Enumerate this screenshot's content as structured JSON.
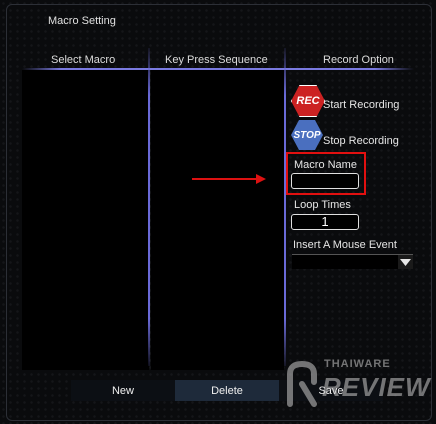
{
  "window": {
    "title": "Macro Setting"
  },
  "columns": {
    "select_macro": "Select Macro",
    "key_press_sequence": "Key Press Sequence",
    "record_option": "Record Option"
  },
  "record": {
    "rec_icon_text": "REC",
    "start_label": "Start Recording",
    "stop_icon_text": "STOP",
    "stop_label": "Stop Recording"
  },
  "macro_name": {
    "label": "Macro Name",
    "value": ""
  },
  "loop_times": {
    "label": "Loop Times",
    "value": "1"
  },
  "mouse_event": {
    "label": "Insert A Mouse Event",
    "selected": ""
  },
  "buttons": {
    "new": "New",
    "delete": "Delete",
    "save": "Save"
  },
  "watermark": {
    "line1": "THAIWARE",
    "line2": "REVIEW"
  },
  "colors": {
    "accent_line": "#6a6ad8",
    "rec": "#cc2222",
    "stop": "#4a6fbf",
    "highlight": "#e21010",
    "delete_bg": "#1e2a3a"
  }
}
